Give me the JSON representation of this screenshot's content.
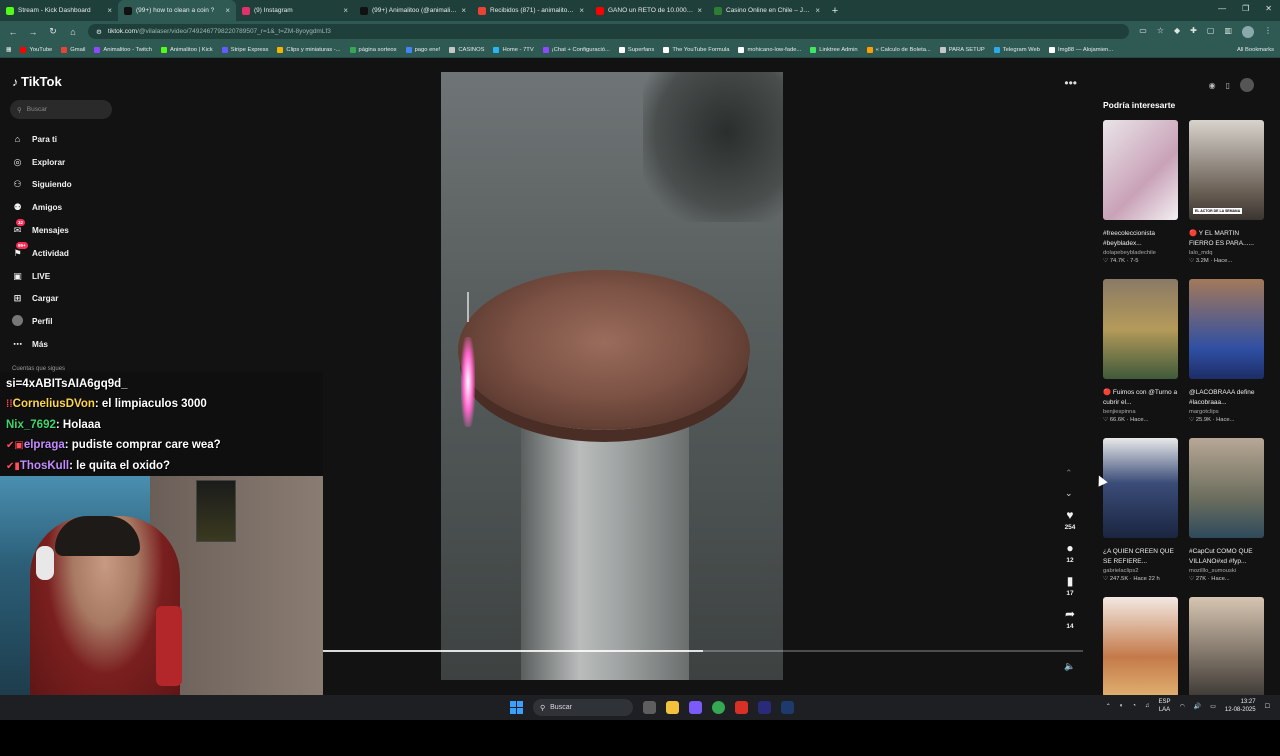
{
  "browser": {
    "tabs": [
      {
        "title": "Stream - Kick Dashboard",
        "color": "#53fc18",
        "active": false
      },
      {
        "title": "(99+) how to clean a coin ?",
        "color": "#111111",
        "active": true
      },
      {
        "title": "(9) Instagram",
        "color": "#e1306c",
        "active": false
      },
      {
        "title": "(99+) Animalitoo (@animalitoo",
        "color": "#111111",
        "active": false
      },
      {
        "title": "Recibidos (871) - animalitoo.str",
        "color": "#ea4335",
        "active": false
      },
      {
        "title": "GANO un RETO de 10.000€ y lo",
        "color": "#ff0000",
        "active": false
      },
      {
        "title": "Casino Online en Chile – Juego",
        "color": "#2e7d32",
        "active": false
      }
    ],
    "address": "tiktok.com",
    "address_path": "/@vilalaser/video/7492467798220789507_r=1&_t=ZM-8yoygdmLf3",
    "bookmarks": [
      {
        "label": "YouTube",
        "color": "#ff0000"
      },
      {
        "label": "Gmail",
        "color": "#ea4335"
      },
      {
        "label": "Animalitoo - Twitch",
        "color": "#9146ff"
      },
      {
        "label": "Animalitoo | Kick",
        "color": "#53fc18"
      },
      {
        "label": "Stripe Express",
        "color": "#635bff"
      },
      {
        "label": "Clips y miniaturas -...",
        "color": "#f4b400"
      },
      {
        "label": "página sorteos",
        "color": "#34a853"
      },
      {
        "label": "pago ene!",
        "color": "#4285f4"
      },
      {
        "label": "CASINOS",
        "color": "#c7c7c7"
      },
      {
        "label": "Home - 7TV",
        "color": "#29b6f6"
      },
      {
        "label": "¡Chat + Configuració...",
        "color": "#9146ff"
      },
      {
        "label": "Superfans",
        "color": "#ffffff"
      },
      {
        "label": "The YouTube Formula",
        "color": "#ffffff"
      },
      {
        "label": "mohicano-low-fade...",
        "color": "#ffffff"
      },
      {
        "label": "Linktree Admin",
        "color": "#43e660"
      },
      {
        "label": "« Calculo de Boleta...",
        "color": "#ffa000"
      },
      {
        "label": "PARA SETUP",
        "color": "#c7c7c7"
      },
      {
        "label": "Telegram Web",
        "color": "#2aabee"
      },
      {
        "label": "Img88 — Alojamien...",
        "color": "#ffffff"
      }
    ],
    "all_bookmarks": "All Bookmarks"
  },
  "tiktok": {
    "logo": "TikTok",
    "search_placeholder": "Buscar",
    "nav": [
      {
        "label": "Para ti",
        "icon": "home-icon",
        "glyph": "⌂"
      },
      {
        "label": "Explorar",
        "icon": "compass-icon",
        "glyph": "◎"
      },
      {
        "label": "Siguiendo",
        "icon": "following-icon",
        "glyph": "⚇"
      },
      {
        "label": "Amigos",
        "icon": "friends-icon",
        "glyph": "⚉"
      },
      {
        "label": "Mensajes",
        "icon": "messages-icon",
        "glyph": "✉",
        "badge": "32"
      },
      {
        "label": "Actividad",
        "icon": "activity-icon",
        "glyph": "⚑",
        "badge": "99+"
      },
      {
        "label": "LIVE",
        "icon": "live-icon",
        "glyph": "▣"
      },
      {
        "label": "Cargar",
        "icon": "upload-icon",
        "glyph": "⊞"
      },
      {
        "label": "Perfil",
        "icon": "profile-icon",
        "glyph": "●"
      },
      {
        "label": "Más",
        "icon": "more-icon",
        "glyph": "⋯"
      }
    ],
    "followed_accounts": "Cuentas que sigues",
    "video": {
      "likes": "254",
      "comments": "12",
      "saves": "17",
      "shares": "14",
      "progress": 0.5
    },
    "suggestions_title": "Podría interesarte",
    "suggestions": [
      {
        "caption": "#freecoleccionista #beybladex...",
        "author": "dolapebeybladechile",
        "views": "74.7K",
        "time": "7-5",
        "bg": "linear-gradient(135deg,#e9e4e7,#c9a2b8 60%,#f3f0f1)",
        "tag": ""
      },
      {
        "caption": "🔴 Y EL MARTIN FIERRO ES PARA......",
        "author": "lalo_mdq",
        "views": "3.2M",
        "time": "Hace...",
        "bg": "linear-gradient(180deg,#d8d3cc,#6c6258 70%,#3b3530)",
        "tag": "EL ACTOR DE LA SEMANA"
      },
      {
        "caption": "🔴 Fuimos con @Turno a cubrir el...",
        "author": "benjiespinna",
        "views": "66.6K",
        "time": "Hace...",
        "bg": "linear-gradient(180deg,#8a7a66,#b49a5a 50%,#3f5a3a)",
        "tag": ""
      },
      {
        "caption": "@LACOBRAAA define #lacobraaa...",
        "author": "margotclips",
        "views": "25.9K",
        "time": "Hace...",
        "bg": "linear-gradient(180deg,#a3795a,#2f4fa3 70%,#1d2d66)",
        "tag": ""
      },
      {
        "caption": "¿A QUIEN CREEN QUE SE REFIERE...",
        "author": "gabrielaclips2",
        "views": "247.5K",
        "time": "Hace 22 h",
        "bg": "linear-gradient(180deg,#e9e9e9,#3a4c78 45%,#1b2540)",
        "tag": ""
      },
      {
        "caption": "#CapCut COMO QUE VILLANO#xd #fyp...",
        "author": "mozilllo_sumouski",
        "views": "27K",
        "time": "Hace...",
        "bg": "linear-gradient(180deg,#b8a796,#6c6e5e 60%,#2e4a5c)",
        "tag": ""
      },
      {
        "caption": "",
        "author": "",
        "views": "",
        "time": "",
        "bg": "linear-gradient(180deg,#f2e8e2,#c47a4a 60%,#e0b070)",
        "tag": ""
      },
      {
        "caption": "",
        "author": "",
        "views": "",
        "time": "",
        "bg": "linear-gradient(180deg,#d7c5b2,#7c7266 60%,#3e3a36)",
        "tag": ""
      }
    ]
  },
  "stream_chat": [
    {
      "user": "si=4xABITsAIA6gq9d_",
      "message": "",
      "badge": "",
      "color": "#ffffff"
    },
    {
      "user": "CorneliusDVon",
      "message": ": el limpiaculos 3000",
      "badge": "⁞⁞",
      "color": "#ffd54a"
    },
    {
      "user": "Nix_7692",
      "message": ": Holaaa",
      "badge": "",
      "color": "#3fd66b"
    },
    {
      "user": "elpraga",
      "message": ": pudiste comprar care wea?",
      "badge": "✔▣",
      "color": "#c48bff"
    },
    {
      "user": "ThosKull",
      "message": ": le quita el oxido?",
      "badge": "✔▮",
      "color": "#c48bff"
    }
  ],
  "taskbar": {
    "search": "Buscar",
    "lang_top": "ESP",
    "lang_bottom": "LAA",
    "time": "13:27",
    "date": "12-08-2025"
  }
}
